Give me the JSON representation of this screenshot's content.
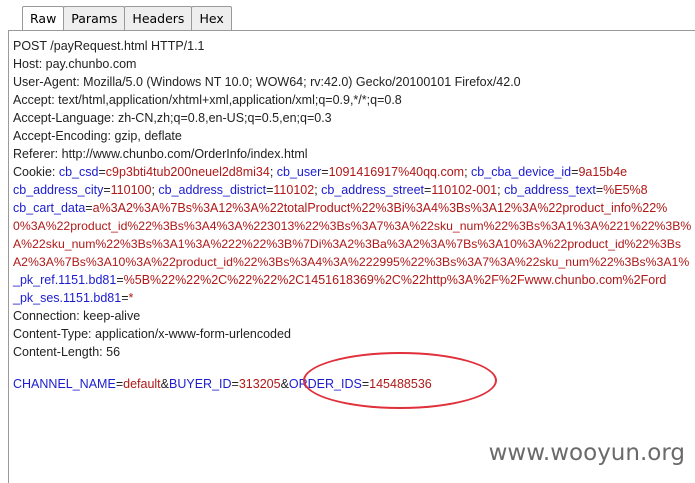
{
  "tabs": [
    "Raw",
    "Params",
    "Headers",
    "Hex"
  ],
  "active_tab": "Raw",
  "request_lines": [
    [
      {
        "c": "t",
        "s": "POST /payRequest.html HTTP/1.1"
      }
    ],
    [
      {
        "c": "t",
        "s": "Host: pay.chunbo.com"
      }
    ],
    [
      {
        "c": "t",
        "s": "User-Agent: Mozilla/5.0 (Windows NT 10.0; WOW64; rv:42.0) Gecko/20100101 Firefox/42.0"
      }
    ],
    [
      {
        "c": "t",
        "s": "Accept: text/html,application/xhtml+xml,application/xml;q=0.9,*/*;q=0.8"
      }
    ],
    [
      {
        "c": "t",
        "s": "Accept-Language: zh-CN,zh;q=0.8,en-US;q=0.5,en;q=0.3"
      }
    ],
    [
      {
        "c": "t",
        "s": "Accept-Encoding: gzip, deflate"
      }
    ],
    [
      {
        "c": "t",
        "s": "Referer: http://www.chunbo.com/OrderInfo/index.html"
      }
    ],
    [
      {
        "c": "t",
        "s": "Cookie: "
      },
      {
        "c": "k",
        "s": "cb_csd"
      },
      {
        "c": "t",
        "s": "="
      },
      {
        "c": "v",
        "s": "c9p3bti4tub200neuel2d8mi34"
      },
      {
        "c": "t",
        "s": "; "
      },
      {
        "c": "k",
        "s": "cb_user"
      },
      {
        "c": "t",
        "s": "="
      },
      {
        "c": "v",
        "s": "1091416917%40qq.com"
      },
      {
        "c": "t",
        "s": "; "
      },
      {
        "c": "k",
        "s": "cb_cba_device_id"
      },
      {
        "c": "t",
        "s": "="
      },
      {
        "c": "v",
        "s": "9a15b4e"
      }
    ],
    [
      {
        "c": "k",
        "s": "cb_address_city"
      },
      {
        "c": "t",
        "s": "="
      },
      {
        "c": "v",
        "s": "110100"
      },
      {
        "c": "t",
        "s": "; "
      },
      {
        "c": "k",
        "s": "cb_address_district"
      },
      {
        "c": "t",
        "s": "="
      },
      {
        "c": "v",
        "s": "110102"
      },
      {
        "c": "t",
        "s": "; "
      },
      {
        "c": "k",
        "s": "cb_address_street"
      },
      {
        "c": "t",
        "s": "="
      },
      {
        "c": "v",
        "s": "110102-001"
      },
      {
        "c": "t",
        "s": "; "
      },
      {
        "c": "k",
        "s": "cb_address_text"
      },
      {
        "c": "t",
        "s": "="
      },
      {
        "c": "v",
        "s": "%E5%8"
      }
    ],
    [
      {
        "c": "k",
        "s": "cb_cart_data"
      },
      {
        "c": "t",
        "s": "="
      },
      {
        "c": "v",
        "s": "a%3A2%3A%7Bs%3A12%3A%22totalProduct%22%3Bi%3A4%3Bs%3A12%3A%22product_info%22%"
      }
    ],
    [
      {
        "c": "v",
        "s": "0%3A%22product_id%22%3Bs%3A4%3A%223013%22%3Bs%3A7%3A%22sku_num%22%3Bs%3A1%3A%221%22%3B%"
      }
    ],
    [
      {
        "c": "v",
        "s": "A%22sku_num%22%3Bs%3A1%3A%222%22%3B%7Di%3A2%3Ba%3A2%3A%7Bs%3A10%3A%22product_id%22%3Bs"
      }
    ],
    [
      {
        "c": "v",
        "s": "A2%3A%7Bs%3A10%3A%22product_id%22%3Bs%3A4%3A%222995%22%3Bs%3A7%3A%22sku_num%22%3Bs%3A1%"
      }
    ],
    [
      {
        "c": "k",
        "s": "_pk_ref.1151.bd81"
      },
      {
        "c": "t",
        "s": "="
      },
      {
        "c": "v",
        "s": "%5B%22%22%2C%22%22%2C1451618369%2C%22http%3A%2F%2Fwww.chunbo.com%2Ford"
      }
    ],
    [
      {
        "c": "k",
        "s": "_pk_ses.1151.bd81"
      },
      {
        "c": "t",
        "s": "="
      },
      {
        "c": "v",
        "s": "*"
      }
    ],
    [
      {
        "c": "t",
        "s": "Connection: keep-alive"
      }
    ],
    [
      {
        "c": "t",
        "s": "Content-Type: application/x-www-form-urlencoded"
      }
    ],
    [
      {
        "c": "t",
        "s": "Content-Length: 56"
      }
    ]
  ],
  "body": [
    {
      "c": "k",
      "s": "CHANNEL_NAME"
    },
    {
      "c": "t",
      "s": "="
    },
    {
      "c": "v",
      "s": "default"
    },
    {
      "c": "t",
      "s": "&"
    },
    {
      "c": "k",
      "s": "BUYER_ID"
    },
    {
      "c": "t",
      "s": "="
    },
    {
      "c": "v",
      "s": "313205"
    },
    {
      "c": "t",
      "s": "&"
    },
    {
      "c": "k",
      "s": "ORDER_IDS"
    },
    {
      "c": "t",
      "s": "="
    },
    {
      "c": "v",
      "s": "145488536"
    }
  ],
  "highlight_color": "#e0303a",
  "watermark": "www.wooyun.org"
}
